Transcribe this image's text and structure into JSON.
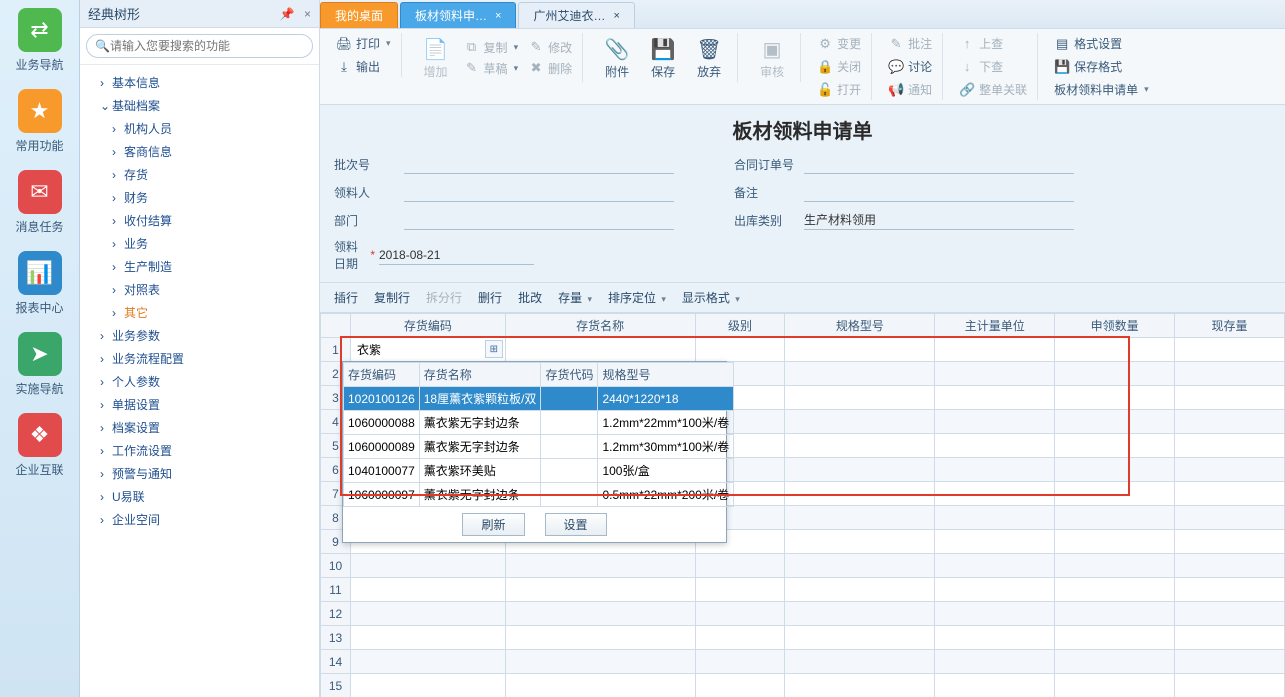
{
  "leftnav": [
    {
      "label": "业务导航",
      "icon": "⇄",
      "bg": "#4fb84f"
    },
    {
      "label": "常用功能",
      "icon": "★",
      "bg": "#f79a2b"
    },
    {
      "label": "消息任务",
      "icon": "✉",
      "bg": "#e14b4b"
    },
    {
      "label": "报表中心",
      "icon": "📊",
      "bg": "#2e8acb"
    },
    {
      "label": "实施导航",
      "icon": "➤",
      "bg": "#3aa66a"
    },
    {
      "label": "企业互联",
      "icon": "❖",
      "bg": "#e14b4b"
    }
  ],
  "treepanel": {
    "title": "经典树形",
    "pin": "📌",
    "close": "×",
    "search_icon": "🔍",
    "search_placeholder": "请输入您要搜索的功能",
    "nodes": [
      {
        "caret": "›",
        "label": "基本信息"
      },
      {
        "caret": "⌄",
        "label": "基础档案",
        "children": [
          {
            "caret": "›",
            "label": "机构人员"
          },
          {
            "caret": "›",
            "label": "客商信息"
          },
          {
            "caret": "›",
            "label": "存货"
          },
          {
            "caret": "›",
            "label": "财务"
          },
          {
            "caret": "›",
            "label": "收付结算"
          },
          {
            "caret": "›",
            "label": "业务"
          },
          {
            "caret": "›",
            "label": "生产制造"
          },
          {
            "caret": "›",
            "label": "对照表"
          },
          {
            "caret": "›",
            "label": "其它",
            "cls": "orange"
          }
        ]
      },
      {
        "caret": "›",
        "label": "业务参数"
      },
      {
        "caret": "›",
        "label": "业务流程配置"
      },
      {
        "caret": "›",
        "label": "个人参数"
      },
      {
        "caret": "›",
        "label": "单据设置"
      },
      {
        "caret": "›",
        "label": "档案设置"
      },
      {
        "caret": "›",
        "label": "工作流设置"
      },
      {
        "caret": "›",
        "label": "预警与通知"
      },
      {
        "caret": "›",
        "label": "U易联"
      },
      {
        "caret": "›",
        "label": "企业空间"
      }
    ]
  },
  "tabs": [
    {
      "label": "我的桌面",
      "cls": "active"
    },
    {
      "label": "板材领料申…",
      "cls": "sel",
      "close": "×"
    },
    {
      "label": "广州艾迪衣…",
      "cls": "",
      "close": "×"
    }
  ],
  "toolbar": {
    "print": "打印",
    "output": "输出",
    "add": "增加",
    "copy": "复制",
    "modify": "修改",
    "draft": "草稿",
    "delete": "删除",
    "attach": "附件",
    "save": "保存",
    "discard": "放弃",
    "audit": "审核",
    "change": "变更",
    "close": "关闭",
    "open": "打开",
    "approve": "批注",
    "discuss": "讨论",
    "notify": "通知",
    "up": "上查",
    "down": "下查",
    "link": "整单关联",
    "fmt": "格式设置",
    "savefmt": "保存格式",
    "doc": "板材领料申请单"
  },
  "form": {
    "title": "板材领料申请单",
    "f1": "批次号",
    "f2": "合同订单号",
    "f3": "领料人",
    "f4": "备注",
    "f5": "部门",
    "f6": "出库类别",
    "f6v": "生产材料领用",
    "f7": "领料日期",
    "f7v": "2018-08-21"
  },
  "gridtb": {
    "ins": "插行",
    "dup": "复制行",
    "split": "拆分行",
    "del": "删行",
    "batch": "批改",
    "stock": "存量",
    "loc": "排序定位",
    "disp": "显示格式"
  },
  "grid": {
    "headers": [
      "",
      "存货编码",
      "存货名称",
      "级别",
      "规格型号",
      "主计量单位",
      "申领数量",
      "现存量"
    ],
    "cell_value": "衣紫",
    "rowcount": 15
  },
  "popup": {
    "headers": [
      "存货编码",
      "存货名称",
      "存货代码",
      "规格型号"
    ],
    "rows": [
      {
        "c0": "1020100126",
        "c1": "18厘薰衣紫颗粒板/双",
        "c2": "",
        "c3": "2440*1220*18",
        "sel": true
      },
      {
        "c0": "1060000088",
        "c1": "薰衣紫无字封边条",
        "c2": "",
        "c3": "1.2mm*22mm*100米/卷"
      },
      {
        "c0": "1060000089",
        "c1": "薰衣紫无字封边条",
        "c2": "",
        "c3": "1.2mm*30mm*100米/卷"
      },
      {
        "c0": "1040100077",
        "c1": "薰衣紫环美贴",
        "c2": "",
        "c3": "100张/盒"
      },
      {
        "c0": "1060000097",
        "c1": "薰衣紫无字封边条",
        "c2": "",
        "c3": "0.5mm*22mm*200米/卷"
      }
    ],
    "refresh": "刷新",
    "settings": "设置"
  }
}
